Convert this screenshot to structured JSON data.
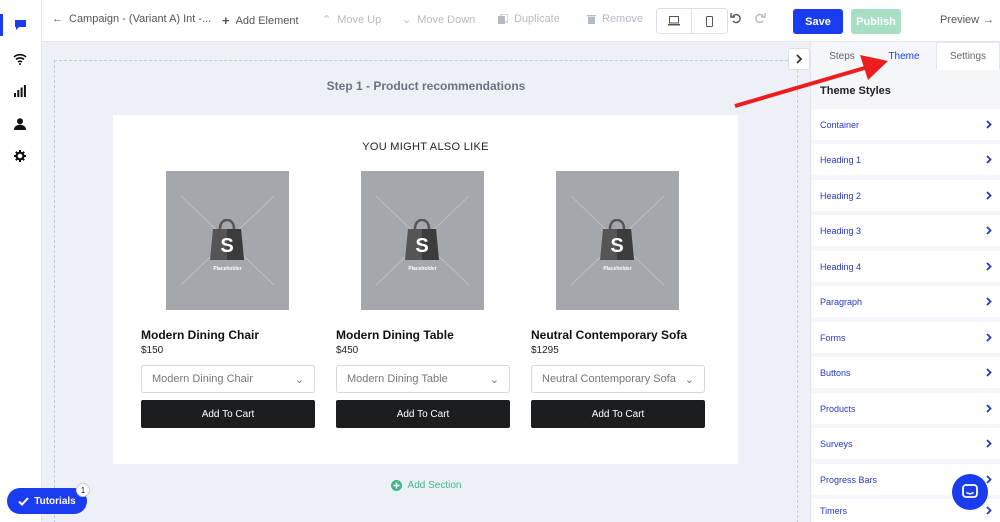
{
  "toolbar": {
    "back_label": "Campaign - (Variant A) Int -...",
    "add_element": "Add Element",
    "move_up": "Move Up",
    "move_down": "Move Down",
    "duplicate": "Duplicate",
    "remove": "Remove",
    "save": "Save",
    "publish": "Publish",
    "preview": "Preview"
  },
  "canvas": {
    "step_title": "Step 1 - Product recommendations",
    "heading": "YOU MIGHT ALSO LIKE",
    "placeholder_label": "Placeholder",
    "add_section": "Add Section",
    "products": [
      {
        "name": "Modern Dining Chair",
        "price": "$150",
        "option": "Modern Dining Chair",
        "button": "Add To Cart"
      },
      {
        "name": "Modern Dining Table",
        "price": "$450",
        "option": "Modern Dining Table",
        "button": "Add To Cart"
      },
      {
        "name": "Neutral Contemporary Sofa",
        "price": "$1295",
        "option": "Neutral Contemporary Sofa",
        "button": "Add To Cart"
      }
    ]
  },
  "panel": {
    "tabs": [
      "Steps",
      "Theme",
      "Settings"
    ],
    "active_tab": "Theme",
    "section_title": "Theme Styles",
    "items": [
      "Container",
      "Heading 1",
      "Heading 2",
      "Heading 3",
      "Heading 4",
      "Paragraph",
      "Forms",
      "Buttons",
      "Products",
      "Surveys",
      "Progress Bars",
      "Timers"
    ]
  },
  "tutorials": {
    "label": "Tutorials",
    "badge": "1"
  },
  "colors": {
    "accent": "#1a3cf0",
    "publish": "#a6dfc4",
    "add_section": "#3fb888",
    "annotation_arrow": "#ee1c1c"
  },
  "icons": [
    "chat-icon",
    "wifi-icon",
    "signal-icon",
    "user-icon",
    "gear-icon",
    "undo-icon",
    "redo-icon",
    "desktop-icon",
    "mobile-icon",
    "chevron-right-icon",
    "shopify-bag-icon",
    "messenger-icon"
  ]
}
